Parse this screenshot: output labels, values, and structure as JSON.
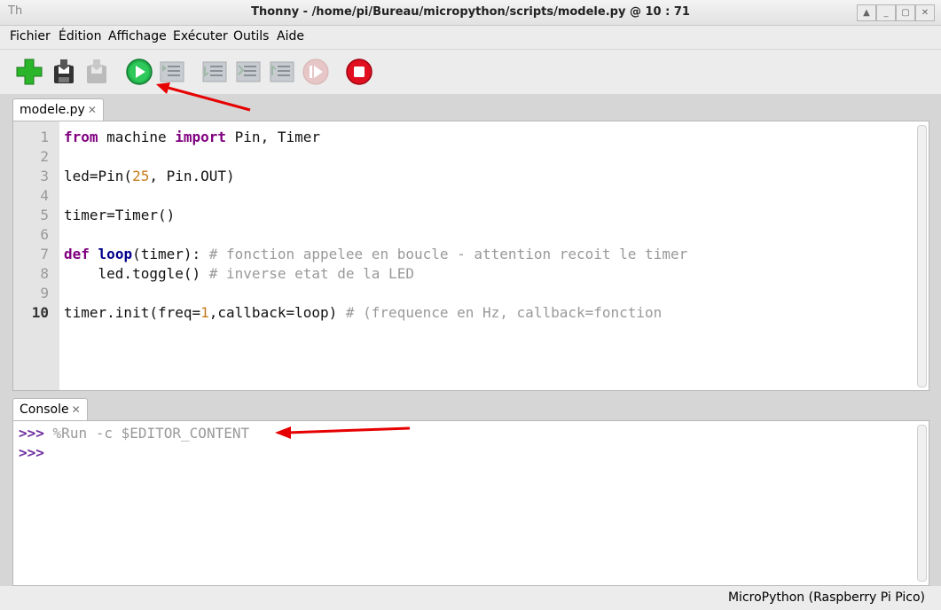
{
  "window": {
    "title": "Thonny  -  /home/pi/Bureau/micropython/scripts/modele.py  @  10 : 71",
    "icon": "thonny-icon"
  },
  "menu": [
    "Fichier",
    "Édition",
    "Affichage",
    "Exécuter",
    "Outils",
    "Aide"
  ],
  "toolbar": {
    "buttons": [
      "new-file",
      "save",
      "save-disabled",
      "run",
      "debug",
      "step-over",
      "step-into",
      "step-out",
      "resume",
      "stop"
    ]
  },
  "editor": {
    "tab_label": "modele.py",
    "tab_close": "✕",
    "line_numbers": [
      "1",
      "2",
      "3",
      "4",
      "5",
      "6",
      "7",
      "8",
      "9",
      "10"
    ],
    "current_line": "10"
  },
  "console": {
    "tab_label": "Console",
    "tab_close": "✕",
    "prompt": ">>>",
    "command": "%Run -c $EDITOR_CONTENT"
  },
  "status": {
    "interpreter": "MicroPython (Raspberry Pi Pico)"
  },
  "colors": {
    "keyword": "#800080",
    "number": "#c77a1a",
    "comment": "#999999",
    "annotation_arrow": "#e60000"
  }
}
